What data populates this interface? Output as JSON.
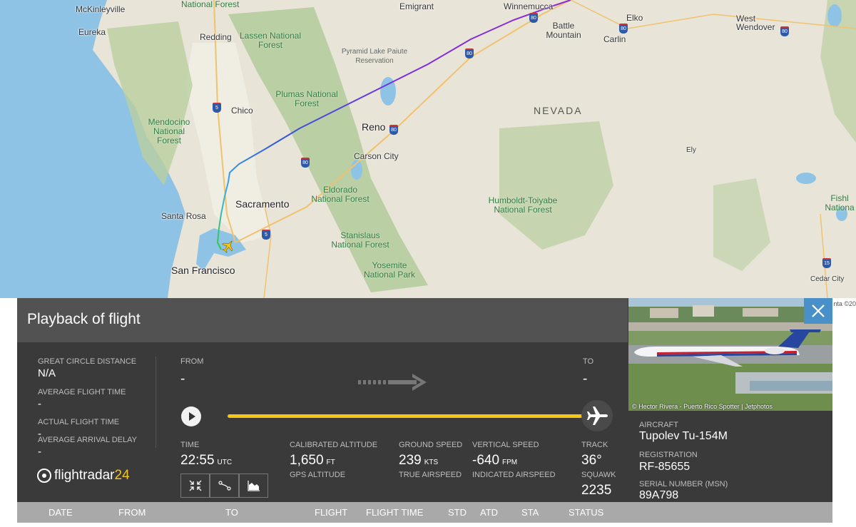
{
  "map": {
    "state_label": "NEVADA",
    "cities": [
      "McKinleyville",
      "Eureka",
      "Redding",
      "Chico",
      "Santa Rosa",
      "San Francisco",
      "Sacramento",
      "Reno",
      "Carson City",
      "Winnemucca",
      "Battle Mountain",
      "Elko",
      "Carlin",
      "West Wendover",
      "Ely",
      "Cedar City",
      "Emigrant"
    ],
    "parks": [
      "Lassen National Forest",
      "Plumas National Forest",
      "Mendocino National Forest",
      "Eldorado National Forest",
      "Stanislaus National Forest",
      "Yosemite National Park",
      "Humboldt-Toiyabe National Forest",
      "Pyramid Lake Paiute Reservation",
      "National Forest",
      "Fishl Nationa"
    ],
    "highways": [
      "80",
      "80",
      "80",
      "80",
      "80",
      "80",
      "5",
      "5",
      "15"
    ],
    "attribution": "nta ©20"
  },
  "panel": {
    "title": "Playback of flight",
    "great_circle_distance_label": "GREAT CIRCLE DISTANCE",
    "great_circle_distance_value": "N/A",
    "average_flight_time_label": "AVERAGE FLIGHT TIME",
    "average_flight_time_value": "-",
    "actual_flight_time_label": "ACTUAL FLIGHT TIME",
    "actual_flight_time_value": "-",
    "average_arrival_delay_label": "AVERAGE ARRIVAL DELAY",
    "average_arrival_delay_value": "-",
    "from_label": "FROM",
    "from_value": "-",
    "to_label": "TO",
    "to_value": "-",
    "progress": 1.0,
    "time_label": "TIME",
    "time_value": "22:55",
    "time_unit": "UTC",
    "calibrated_altitude_label": "CALIBRATED ALTITUDE",
    "calibrated_altitude_value": "1,650",
    "calibrated_altitude_unit": "FT",
    "gps_altitude_label": "GPS ALTITUDE",
    "ground_speed_label": "GROUND SPEED",
    "ground_speed_value": "239",
    "ground_speed_unit": "KTS",
    "true_airspeed_label": "TRUE AIRSPEED",
    "vertical_speed_label": "VERTICAL SPEED",
    "vertical_speed_value": "-640",
    "vertical_speed_unit": "FPM",
    "indicated_airspeed_label": "INDICATED AIRSPEED",
    "track_label": "TRACK",
    "track_value": "36°",
    "squawk_label": "SQUAWK",
    "squawk_value": "2235",
    "logo_text_main": "flightradar",
    "logo_text_accent": "24",
    "tools": [
      "fullscreen-icon",
      "route-icon",
      "chart-icon"
    ]
  },
  "aircraft": {
    "photo_credit": "© Hector Rivera - Puerto Rico Spotter | Jetphotos",
    "aircraft_label": "AIRCRAFT",
    "aircraft_value": "Tupolev Tu-154M",
    "registration_label": "REGISTRATION",
    "registration_value": "RF-85655",
    "serial_label": "SERIAL NUMBER (MSN)",
    "serial_value": "89A798"
  },
  "table": {
    "columns": [
      "DATE",
      "FROM",
      "TO",
      "FLIGHT",
      "FLIGHT TIME",
      "STD",
      "ATD",
      "STA",
      "STATUS"
    ]
  },
  "colors": {
    "track_gradient": [
      "#2ecc40",
      "#3ab0e8",
      "#2e5ad9",
      "#7a2ee0",
      "#8e2bd0"
    ],
    "progress": "#f5c518",
    "close_button": "#4a90c8",
    "panel_bg": "#3a3a3a",
    "header_bg": "#525252"
  }
}
